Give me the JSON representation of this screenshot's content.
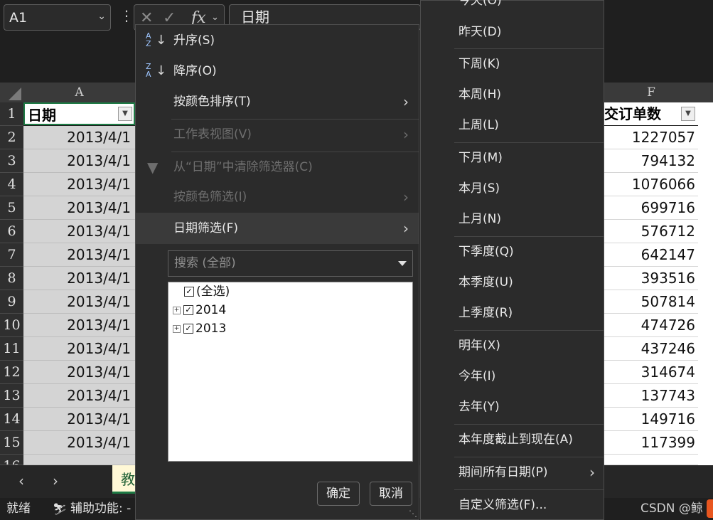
{
  "formula_bar": {
    "name_box": "A1",
    "formula": "日期"
  },
  "grid": {
    "col_a": "A",
    "col_f": "F",
    "header_a": "日期",
    "header_f": "交订单数",
    "rows": [
      {
        "num": "1"
      },
      {
        "num": "2",
        "a": "2013/4/1",
        "f": "1227057"
      },
      {
        "num": "3",
        "a": "2013/4/1",
        "f": "794132"
      },
      {
        "num": "4",
        "a": "2013/4/1",
        "f": "1076066"
      },
      {
        "num": "5",
        "a": "2013/4/1",
        "f": "699716"
      },
      {
        "num": "6",
        "a": "2013/4/1",
        "f": "576712"
      },
      {
        "num": "7",
        "a": "2013/4/1",
        "f": "642147"
      },
      {
        "num": "8",
        "a": "2013/4/1",
        "f": "393516"
      },
      {
        "num": "9",
        "a": "2013/4/1",
        "f": "507814"
      },
      {
        "num": "10",
        "a": "2013/4/1",
        "f": "474726"
      },
      {
        "num": "11",
        "a": "2013/4/1",
        "f": "437246"
      },
      {
        "num": "12",
        "a": "2013/4/1",
        "f": "314674"
      },
      {
        "num": "13",
        "a": "2013/4/1",
        "f": "137743"
      },
      {
        "num": "14",
        "a": "2013/4/1",
        "f": "149716"
      },
      {
        "num": "15",
        "a": "2013/4/1",
        "f": "117399"
      }
    ]
  },
  "filter_menu": {
    "sort_asc": "升序(S)",
    "sort_desc": "降序(O)",
    "sort_by_color": "按颜色排序(T)",
    "sheet_view": "工作表视图(V)",
    "clear_filter": "从“日期”中清除筛选器(C)",
    "filter_by_color": "按颜色筛选(I)",
    "date_filter": "日期筛选(F)",
    "search_placeholder": "搜索 (全部)",
    "tree": [
      "(全选)",
      "2014",
      "2013"
    ],
    "ok": "确定",
    "cancel": "取消"
  },
  "date_submenu": {
    "today": "今天(O)",
    "yesterday": "昨天(D)",
    "next_week": "下周(K)",
    "this_week": "本周(H)",
    "last_week": "上周(L)",
    "next_month": "下月(M)",
    "this_month": "本月(S)",
    "last_month": "上月(N)",
    "next_quarter": "下季度(Q)",
    "this_quarter": "本季度(U)",
    "last_quarter": "上季度(R)",
    "next_year": "明年(X)",
    "this_year": "今年(I)",
    "last_year": "去年(Y)",
    "ytd": "本年度截止到现在(A)",
    "all_dates": "期间所有日期(P)",
    "custom": "自定义筛选(F)..."
  },
  "sheet_tab": "教",
  "status": {
    "ready": "就绪",
    "accessibility": "辅助功能: -"
  },
  "watermark": "CSDN @鲸"
}
